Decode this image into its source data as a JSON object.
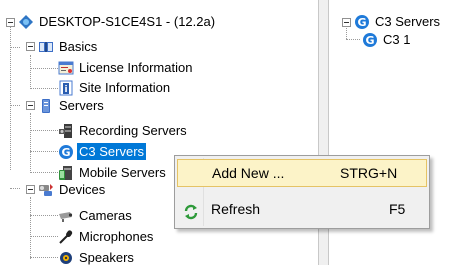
{
  "left_tree": {
    "root": "DESKTOP-S1CE4S1 - (12.2a)",
    "basics": {
      "label": "Basics",
      "children": [
        "License Information",
        "Site Information"
      ]
    },
    "servers": {
      "label": "Servers",
      "children": [
        "Recording Servers",
        "C3 Servers",
        "Mobile Servers"
      ]
    },
    "devices": {
      "label": "Devices",
      "children": [
        "Cameras",
        "Microphones",
        "Speakers"
      ]
    }
  },
  "right_tree": {
    "root": "C3 Servers",
    "children": [
      "C3 1"
    ]
  },
  "context_menu": {
    "items": [
      {
        "label": "Add New ...",
        "shortcut": "STRG+N",
        "highlighted": true
      },
      {
        "label": "Refresh",
        "shortcut": "F5",
        "icon": "refresh-icon"
      }
    ]
  },
  "colors": {
    "selection": "#0078d7",
    "menu_highlight": "#fcf3c8",
    "menu_highlight_border": "#e5c365",
    "menu_bg": "#f0f0f0"
  }
}
